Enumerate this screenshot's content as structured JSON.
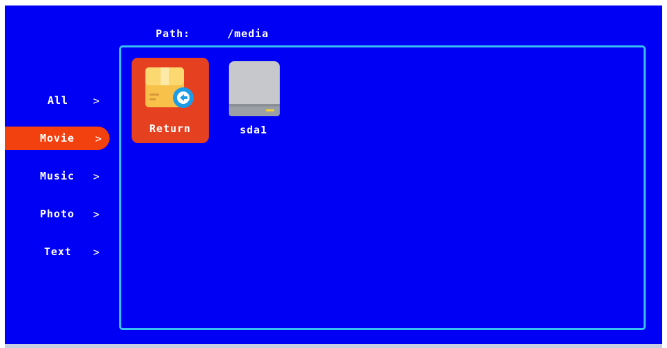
{
  "path": {
    "label": "Path:",
    "value": "/media"
  },
  "menu": [
    {
      "label": "All",
      "chevron": ">",
      "active": false
    },
    {
      "label": "Movie",
      "chevron": ">",
      "active": true
    },
    {
      "label": "Music",
      "chevron": ">",
      "active": false
    },
    {
      "label": "Photo",
      "chevron": ">",
      "active": false
    },
    {
      "label": "Text",
      "chevron": ">",
      "active": false
    }
  ],
  "files": [
    {
      "name": "Return",
      "icon": "return-folder-icon",
      "selected": true
    },
    {
      "name": "sda1",
      "icon": "drive-icon",
      "selected": false
    }
  ],
  "colors": {
    "background": "#0000f5",
    "accent": "#f2400f",
    "frame": "#39c0f2",
    "selected_tile": "#e5401f"
  }
}
